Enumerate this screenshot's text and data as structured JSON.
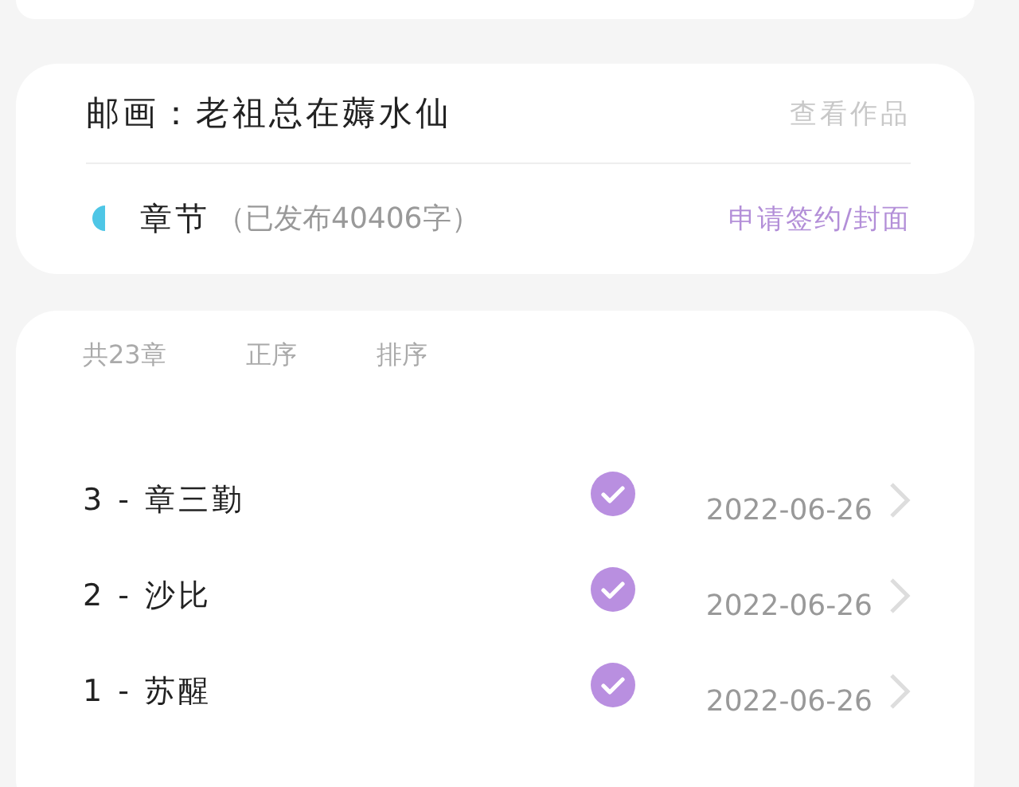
{
  "work": {
    "title": "邮画：老祖总在薅水仙",
    "view_link": "查看作品"
  },
  "chapter_section": {
    "label": "章节",
    "stats": "（已发布40406字）",
    "apply_link": "申请签约/封面"
  },
  "chapter_list": {
    "count": "共23章",
    "order": "正序",
    "sort": "排序",
    "chapters": [
      {
        "title": "3 - 章三勤",
        "checked": true,
        "date": "2022-06-26"
      },
      {
        "title": "2 - 沙比",
        "checked": true,
        "date": "2022-06-26"
      },
      {
        "title": "1 - 苏醒",
        "checked": true,
        "date": "2022-06-26"
      }
    ]
  }
}
